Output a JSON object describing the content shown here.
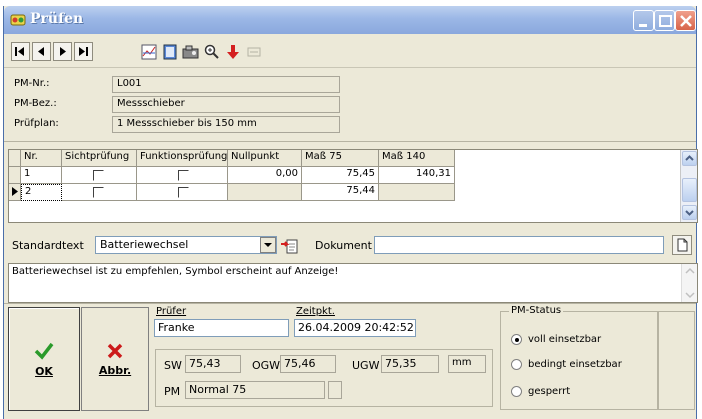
{
  "window": {
    "title": "Prüfen",
    "colors": {
      "titlebar": "#9bb7e6",
      "face": "#ece9d8",
      "accent_red": "#d8644a"
    }
  },
  "toolbar": {
    "icons": [
      "first-record-icon",
      "previous-record-icon",
      "next-record-icon",
      "last-record-icon",
      "chart-icon",
      "form-icon",
      "machine-icon",
      "zoom-icon",
      "arrow-down-red-icon",
      "disabled-icon"
    ]
  },
  "header": {
    "pm_nr_label": "PM-Nr.:",
    "pm_nr_value": "L001",
    "pm_bez_label": "PM-Bez.:",
    "pm_bez_value": "Messschieber",
    "pruefplan_label": "Prüfplan:",
    "pruefplan_value": "1 Messschieber bis 150 mm"
  },
  "grid": {
    "columns": [
      "Nr.",
      "Sichtprüfung",
      "Funktionsprüfung",
      "Nullpunkt",
      "Maß 75",
      "Maß 140"
    ],
    "rows": [
      {
        "nr": "1",
        "nullpunkt": "0,00",
        "mass75": "75,45",
        "mass140": "140,31"
      },
      {
        "nr": "2",
        "nullpunkt": "",
        "mass75": "75,44",
        "mass140": ""
      }
    ]
  },
  "standardtext": {
    "label": "Standardtext",
    "value": "Batteriewechsel",
    "dokument_label": "Dokument",
    "dokument_value": ""
  },
  "memo": {
    "text": "Batteriewechsel ist zu empfehlen, Symbol erscheint auf Anzeige!"
  },
  "buttons": {
    "ok": "OK",
    "abbr": "Abbr."
  },
  "pruefer": {
    "label": "Prüfer",
    "value": "Franke"
  },
  "zeitpkt": {
    "label": "Zeitpkt.",
    "value": "26.04.2009 20:42:52"
  },
  "measures": {
    "sw_label": "SW",
    "sw_value": "75,43",
    "ogw_label": "OGW",
    "ogw_value": "75,46",
    "ugw_label": "UGW",
    "ugw_value": "75,35",
    "unit": "mm",
    "pm_label": "PM",
    "pm_value": "Normal 75"
  },
  "pm_status": {
    "title": "PM-Status",
    "options": [
      "voll einsetzbar",
      "bedingt einsetzbar",
      "gesperrt"
    ],
    "selected": "voll einsetzbar"
  }
}
